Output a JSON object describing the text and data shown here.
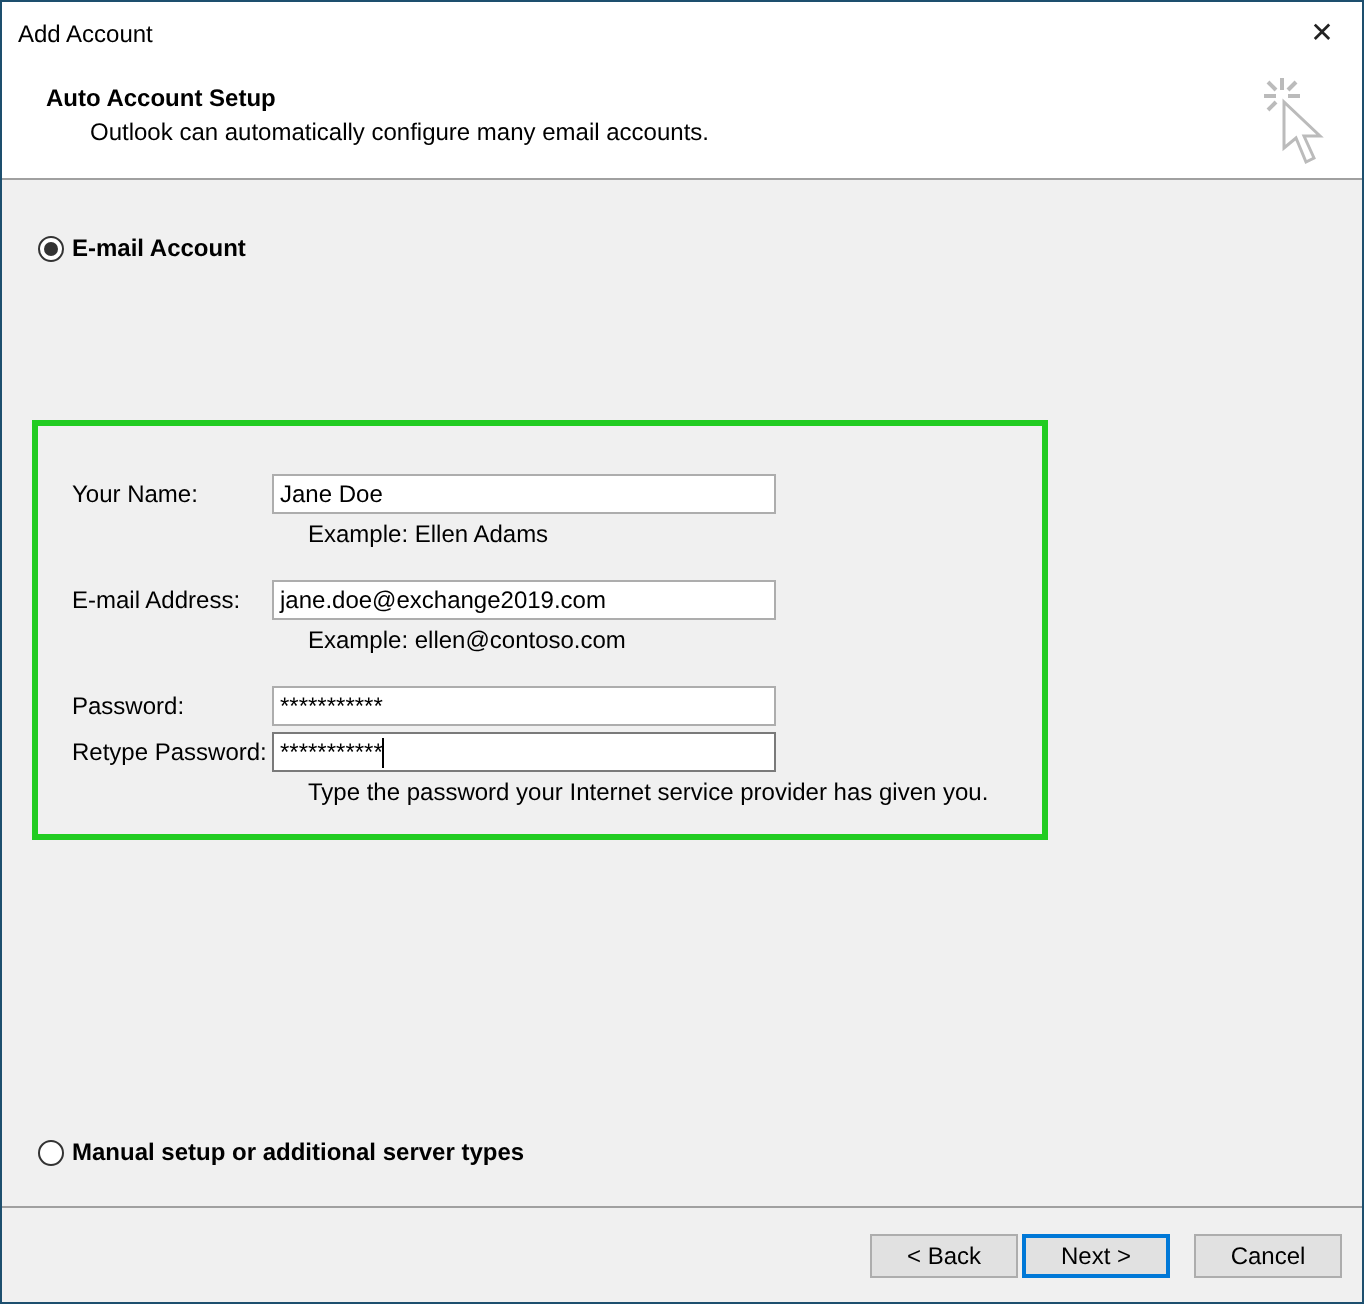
{
  "window": {
    "title": "Add Account",
    "close": "✕"
  },
  "header": {
    "title": "Auto Account Setup",
    "subtitle": "Outlook can automatically configure many email accounts."
  },
  "options": [
    {
      "kind": "email",
      "label": "E-mail Account",
      "selected": true
    },
    {
      "kind": "manual",
      "label": "Manual setup or additional server types",
      "selected": false
    }
  ],
  "fields": [
    {
      "label": "Your Name:",
      "value": "Jane Doe",
      "hint": "Example: Ellen Adams",
      "focused": false
    },
    {
      "label": "E-mail Address:",
      "value": "jane.doe@exchange2019.com",
      "hint": "Example: ellen@contoso.com",
      "focused": false
    },
    {
      "label": "Password:",
      "value": "***********",
      "focused": false
    },
    {
      "label": "Retype Password:",
      "value": "***********",
      "hint": "Type the password your Internet service provider has given you.",
      "focused": true
    }
  ],
  "buttons": [
    {
      "label": "< Back",
      "default": false
    },
    {
      "label": "Next >",
      "default": true
    },
    {
      "label": "Cancel",
      "default": false
    }
  ]
}
